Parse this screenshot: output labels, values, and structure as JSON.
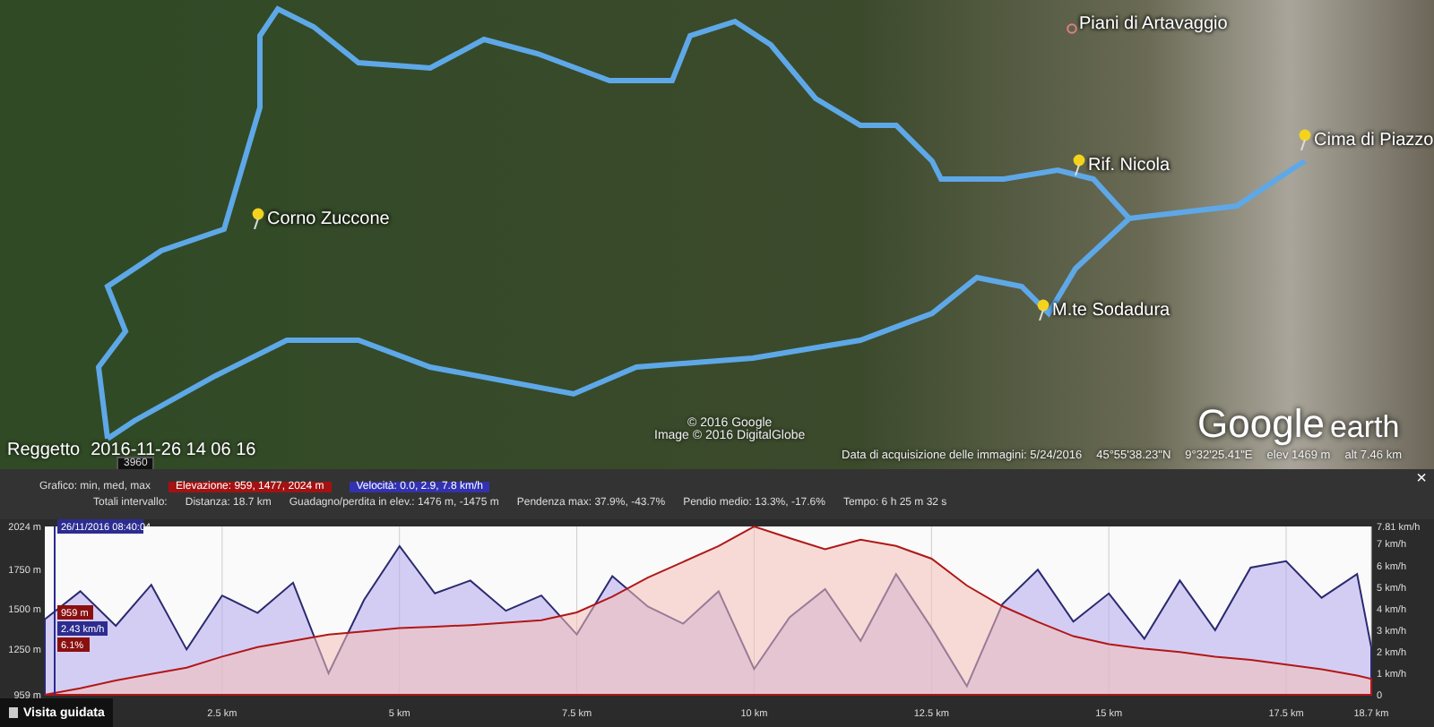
{
  "map": {
    "placemarks": [
      {
        "label": "Piani di Artavaggio",
        "kind": "dot"
      },
      {
        "label": "Rif. Nicola",
        "kind": "pin"
      },
      {
        "label": "Cima di Piazzo",
        "kind": "pin"
      },
      {
        "label": "M.te Sodadura",
        "kind": "pin"
      },
      {
        "label": "Corno Zuccone",
        "kind": "pin"
      }
    ],
    "timestamp": {
      "place": "Reggetto",
      "time": "2016-11-26 14 06 16"
    },
    "badge": "3960",
    "copyright": [
      "© 2016 Google",
      "Image © 2016 DigitalGlobe"
    ],
    "logo": {
      "brand": "Google",
      "product": "earth"
    },
    "status": [
      "Data di acquisizione delle immagini: 5/24/2016",
      "45°55'38.23\"N",
      "9°32'25.41\"E",
      "elev 1469 m",
      "alt 7.46 km"
    ]
  },
  "profile_bar": {
    "row1_label": "Grafico: min, med, max",
    "elevation": "Elevazione: 959, 1477, 2024 m",
    "speed": "Velocità: 0.0, 2.9, 7.8 km/h",
    "row2_label": "Totali intervallo:",
    "totals": [
      "Distanza: 18.7 km",
      "Guadagno/perdita in elev.: 1476 m, -1475 m",
      "Pendenza max: 37.9%, -43.7%",
      "Pendio medio: 13.3%, -17.6%",
      "Tempo: 6 h 25 m 32 s"
    ],
    "close": "×"
  },
  "chart": {
    "cursor_time": "26/11/2016 08:40:04",
    "readings": {
      "elevation": "959 m",
      "speed": "2.43 km/h",
      "slope": "6.1%"
    },
    "chart_data": {
      "type": "area",
      "xlim": [
        0,
        18.7
      ],
      "ylim": [
        959,
        2024
      ],
      "xticks": [
        {
          "value": 2.5,
          "label": "2.5 km"
        },
        {
          "value": 5,
          "label": "5 km"
        },
        {
          "value": 7.5,
          "label": "7.5 km"
        },
        {
          "value": 10,
          "label": "10 km"
        },
        {
          "value": 12.5,
          "label": "12.5 km"
        },
        {
          "value": 15,
          "label": "15 km"
        },
        {
          "value": 17.5,
          "label": "17.5 km"
        },
        {
          "value": 18.7,
          "label": "18.7 km"
        }
      ],
      "yticks": [
        {
          "value": 959,
          "label": "959 m"
        },
        {
          "value": 1250,
          "label": "1250 m"
        },
        {
          "value": 1500,
          "label": "1500 m"
        },
        {
          "value": 1750,
          "label": "1750 m"
        },
        {
          "value": 2024,
          "label": "2024 m"
        }
      ],
      "y2lim": [
        0,
        7.81
      ],
      "grid": true,
      "y2ticks": [
        {
          "value": 0,
          "label": "0"
        },
        {
          "value": 1,
          "label": "1 km/h"
        },
        {
          "value": 2,
          "label": "2 km/h"
        },
        {
          "value": 3,
          "label": "3 km/h"
        },
        {
          "value": 4,
          "label": "4 km/h"
        },
        {
          "value": 5,
          "label": "5 km/h"
        },
        {
          "value": 6,
          "label": "6 km/h"
        },
        {
          "value": 7,
          "label": "7 km/h"
        },
        {
          "value": 7.81,
          "label": "7.81 km/h"
        }
      ],
      "x": [
        0,
        0.5,
        1,
        1.5,
        2,
        2.5,
        3,
        3.5,
        4,
        4.5,
        5,
        5.5,
        6,
        6.5,
        7,
        7.5,
        8,
        8.5,
        9,
        9.5,
        10,
        10.5,
        11,
        11.5,
        12,
        12.5,
        13,
        13.5,
        14,
        14.5,
        15,
        15.5,
        16,
        16.5,
        17,
        17.5,
        18,
        18.5,
        18.7
      ],
      "series": [
        {
          "color": "#b01818",
          "values": [
            959,
            1000,
            1050,
            1090,
            1130,
            1200,
            1260,
            1300,
            1340,
            1360,
            1380,
            1390,
            1400,
            1415,
            1430,
            1480,
            1580,
            1700,
            1800,
            1900,
            2024,
            1950,
            1880,
            1940,
            1900,
            1820,
            1650,
            1520,
            1420,
            1330,
            1280,
            1250,
            1230,
            1200,
            1180,
            1150,
            1120,
            1080,
            1060
          ]
        },
        {
          "color": "#2a2a70",
          "axis": "y2",
          "values": [
            3.5,
            4.8,
            3.2,
            5.1,
            2.1,
            4.6,
            3.8,
            5.2,
            1.0,
            4.4,
            6.9,
            4.7,
            5.3,
            3.9,
            4.6,
            2.8,
            5.5,
            4.1,
            3.3,
            4.8,
            1.2,
            3.6,
            4.9,
            2.5,
            5.6,
            3.1,
            0.4,
            4.2,
            5.8,
            3.4,
            4.7,
            2.6,
            5.3,
            3.0,
            5.9,
            6.2,
            4.5,
            5.6,
            2.2
          ]
        }
      ]
    }
  },
  "tour_button": "Visita guidata"
}
